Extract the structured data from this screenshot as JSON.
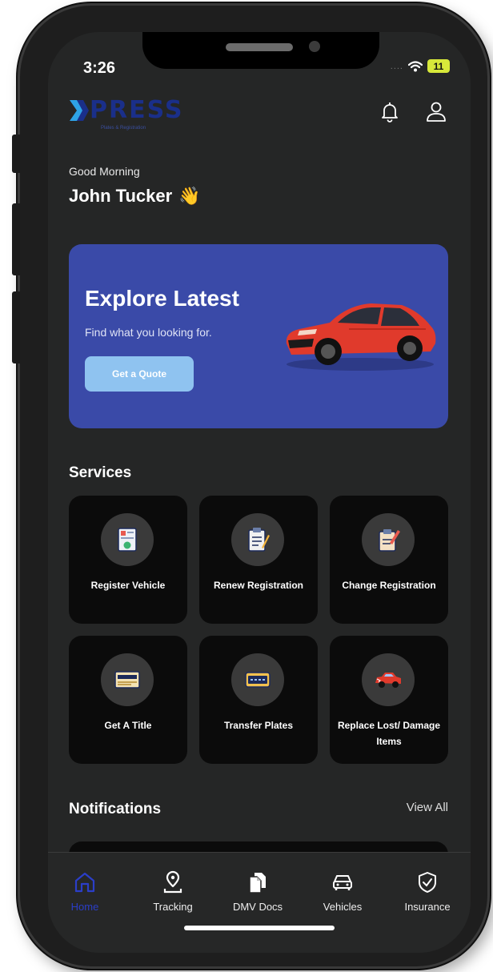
{
  "status": {
    "time": "3:26",
    "signal_dots": "....",
    "battery": "11"
  },
  "header": {
    "logo_text": "PRESS",
    "logo_subtitle": "Plates & Registration"
  },
  "greeting": {
    "small": "Good Morning",
    "name": "John Tucker",
    "emoji": "👋"
  },
  "banner": {
    "title": "Explore Latest",
    "subtitle": "Find what you looking for.",
    "button": "Get a Quote"
  },
  "services": {
    "title": "Services",
    "items": [
      {
        "label": "Register Vehicle",
        "icon": "registration-form-icon"
      },
      {
        "label": "Renew Registration",
        "icon": "clipboard-pen-icon"
      },
      {
        "label": "Change Registration",
        "icon": "edit-document-icon"
      },
      {
        "label": "Get A Title",
        "icon": "title-certificate-icon"
      },
      {
        "label": "Transfer Plates",
        "icon": "license-plate-icon"
      },
      {
        "label": "Replace Lost/ Damage Items",
        "icon": "damaged-car-icon"
      }
    ]
  },
  "notifications": {
    "title": "Notifications",
    "view_all": "View All"
  },
  "tabs": [
    {
      "label": "Home",
      "icon": "home-icon",
      "active": true
    },
    {
      "label": "Tracking",
      "icon": "location-pin-icon"
    },
    {
      "label": "DMV Docs",
      "icon": "documents-icon"
    },
    {
      "label": "Vehicles",
      "icon": "car-icon"
    },
    {
      "label": "Insurance",
      "icon": "shield-check-icon"
    }
  ],
  "colors": {
    "background": "#252626",
    "card": "#0b0b0b",
    "banner": "#3a4aa8",
    "button": "#8fc3f0",
    "accent": "#2b3ec8"
  }
}
